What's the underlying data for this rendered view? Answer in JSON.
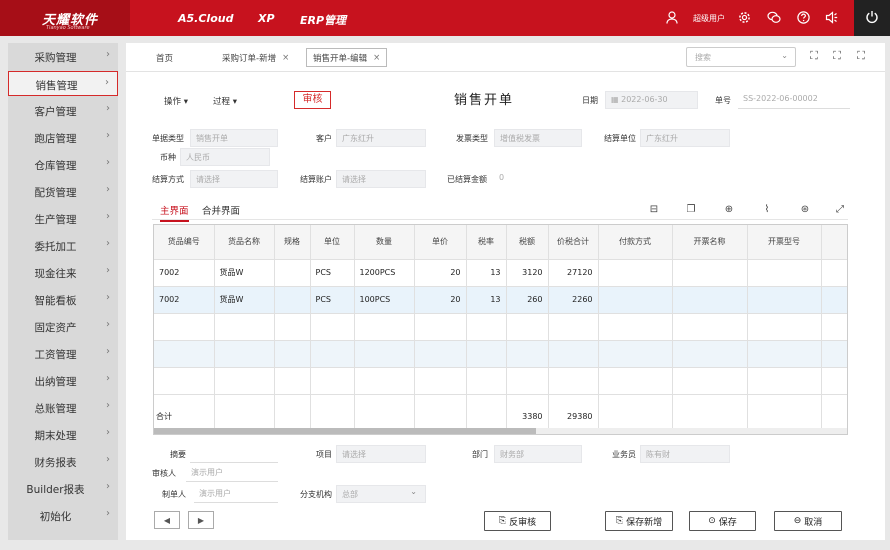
{
  "app": {
    "logo_main": "天耀软件",
    "logo_sub": "Tianyao Software",
    "nav": [
      "A5.Cloud",
      "XP",
      "ERP管理"
    ],
    "user_name": "超级用户",
    "icons": [
      "user-icon",
      "gear-icon",
      "chat-icon",
      "help-icon",
      "notification-icon",
      "power-icon"
    ]
  },
  "sidebar": {
    "items": [
      {
        "label": "采购管理"
      },
      {
        "label": "销售管理"
      },
      {
        "label": "客户管理"
      },
      {
        "label": "跑店管理"
      },
      {
        "label": "仓库管理"
      },
      {
        "label": "配货管理"
      },
      {
        "label": "生产管理"
      },
      {
        "label": "委托加工"
      },
      {
        "label": "现金往来"
      },
      {
        "label": "智能看板"
      },
      {
        "label": "固定资产"
      },
      {
        "label": "工资管理"
      },
      {
        "label": "出纳管理"
      },
      {
        "label": "总账管理"
      },
      {
        "label": "期末处理"
      },
      {
        "label": "财务报表"
      },
      {
        "label": "Builder报表"
      },
      {
        "label": "初始化"
      }
    ],
    "chevron": "›"
  },
  "tabs": {
    "items": [
      {
        "label": "首页"
      },
      {
        "label": "采购订单-新增"
      },
      {
        "label": "销售开单-编辑"
      }
    ],
    "close": "×",
    "search_placeholder": "搜索"
  },
  "toolbar": {
    "ops_label": "操作",
    "process_label": "过程",
    "audit_label": "审核",
    "title": "销售开单",
    "date_label": "日期",
    "date_value": "2022-06-30",
    "no_label": "单号",
    "no_value": "SS-2022-06-00002"
  },
  "form": {
    "doc_type_label": "单据类型",
    "doc_type_value": "销售开单",
    "customer_label": "客户",
    "customer_value": "广东红升",
    "invoice_type_label": "发票类型",
    "invoice_type_value": "增值税发票",
    "settle_unit_label": "结算单位",
    "settle_unit_value": "广东红升",
    "currency_label": "币种",
    "currency_value": "人民币",
    "settle_method_label": "结算方式",
    "settle_method_placeholder": "请选择",
    "settle_account_label": "结算账户",
    "settle_account_placeholder": "请选择",
    "settled_amount_label": "已结算金额",
    "settled_amount_value": "0"
  },
  "subtabs": {
    "main": "主界面",
    "merged": "合并界面"
  },
  "grid": {
    "columns": [
      "货品编号",
      "货品名称",
      "规格",
      "单位",
      "数量",
      "单价",
      "税率",
      "税额",
      "价税合计",
      "付款方式",
      "开票名称",
      "开票型号"
    ],
    "rows": [
      [
        "7002",
        "货品W",
        "",
        "PCS",
        "1200PCS",
        "20",
        "13",
        "3120",
        "27120",
        "",
        "",
        ""
      ],
      [
        "7002",
        "货品W",
        "",
        "PCS",
        "100PCS",
        "20",
        "13",
        "260",
        "2260",
        "",
        "",
        ""
      ]
    ],
    "summary_label": "合计",
    "summary_tax": "3380",
    "summary_total": "29380"
  },
  "bottom": {
    "summary_label": "摘要",
    "project_label": "项目",
    "project_placeholder": "请选择",
    "dept_label": "部门",
    "dept_value": "财务部",
    "salesman_label": "业务员",
    "salesman_value": "陈有财",
    "auditor_label": "审核人",
    "auditor_value": "演示用户",
    "maker_label": "制单人",
    "maker_value": "演示用户",
    "branch_label": "分支机构",
    "branch_value": "总部"
  },
  "actions": {
    "prev": "◀",
    "next": "▶",
    "unaudit": "反审核",
    "save_new": "保存新增",
    "save": "保存",
    "cancel": "取消"
  }
}
